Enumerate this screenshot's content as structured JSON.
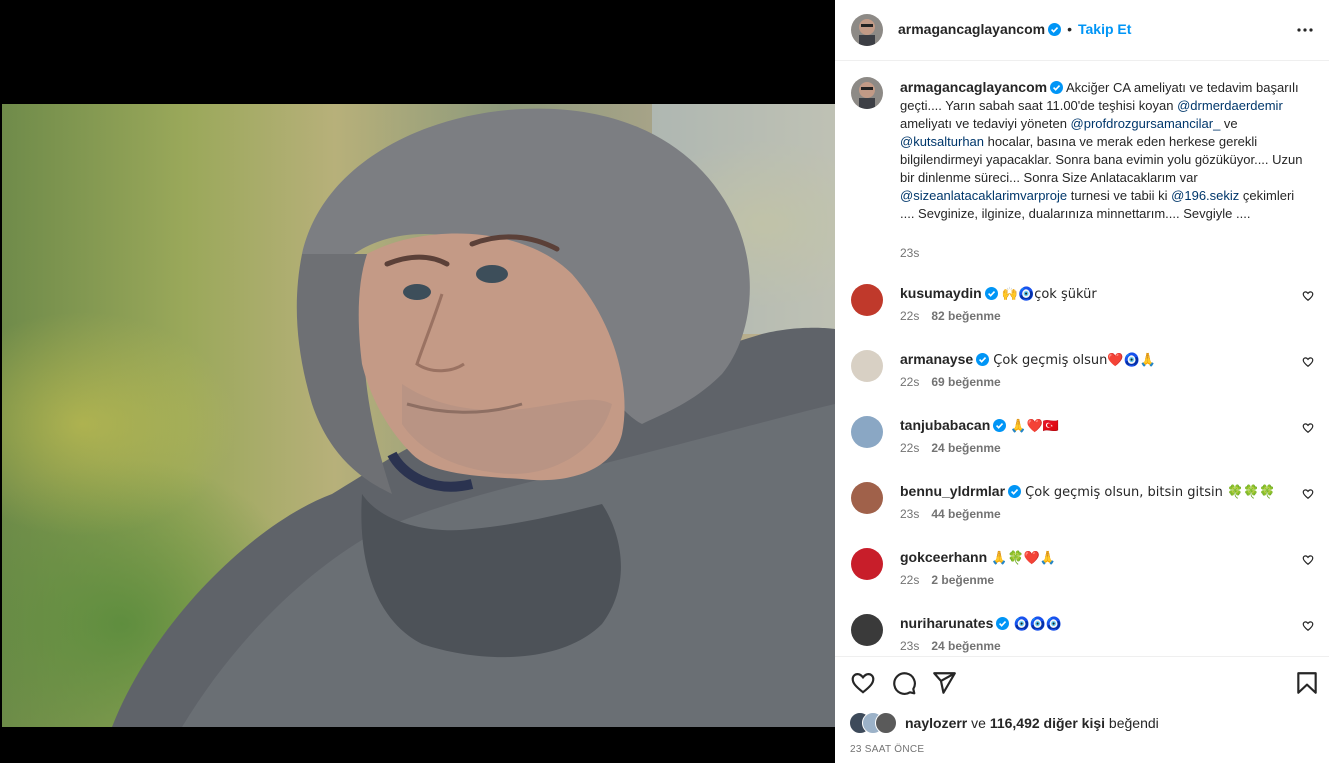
{
  "post": {
    "author": "armagancaglayancom",
    "follow_label": "Takip Et",
    "dot": "•",
    "caption_parts": [
      {
        "t": "Akciğer CA ameliyatı ve tedavim başarılı geçti.... Yarın sabah saat 11.00'de teşhisi koyan ",
        "m": false
      },
      {
        "t": "@drmerdaerdemir",
        "m": true
      },
      {
        "t": " ameliyatı ve tedaviyi yöneten ",
        "m": false
      },
      {
        "t": "@profdrozgursamancilar_",
        "m": true
      },
      {
        "t": " ve ",
        "m": false
      },
      {
        "t": "@kutsalturhan",
        "m": true
      },
      {
        "t": " hocalar, basına ve merak eden herkese gerekli bilgilendirmeyi yapacaklar. Sonra bana evimin yolu gözüküyor.... Uzun bir dinlenme süreci... Sonra Size Anlatacaklarım var ",
        "m": false
      },
      {
        "t": "@sizeanlatacaklarimvarproje",
        "m": true
      },
      {
        "t": " turnesi ve tabii ki ",
        "m": false
      },
      {
        "t": "@196.sekiz",
        "m": true
      },
      {
        "t": " çekimleri .... Sevginize, ilginize, dualarınıza minnettarım.... Sevgiyle ....",
        "m": false
      }
    ],
    "caption_time": "23s"
  },
  "comments": [
    {
      "user": "kusumaydin",
      "verified": true,
      "text": "🙌🧿çok şükür",
      "time": "22s",
      "likes": "82 beğenme",
      "avatar_color": "#c0392b"
    },
    {
      "user": "armanayse",
      "verified": true,
      "text": "Çok geçmiş olsun❤️🧿🙏",
      "time": "22s",
      "likes": "69 beğenme",
      "avatar_color": "#d8d0c4"
    },
    {
      "user": "tanjubabacan",
      "verified": true,
      "text": "🙏❤️🇹🇷",
      "time": "22s",
      "likes": "24 beğenme",
      "avatar_color": "#8aa7c4"
    },
    {
      "user": "bennu_yldrmlar",
      "verified": true,
      "text": "Çok geçmiş olsun, bitsin gitsin 🍀🍀🍀",
      "time": "23s",
      "likes": "44 beğenme",
      "avatar_color": "#a0614a"
    },
    {
      "user": "gokceerhann",
      "verified": false,
      "text": "🙏🍀❤️🙏",
      "time": "22s",
      "likes": "2 beğenme",
      "avatar_color": "#c81e2a"
    },
    {
      "user": "nuriharunates",
      "verified": true,
      "text": "🧿🧿🧿",
      "time": "23s",
      "likes": "24 beğenme",
      "avatar_color": "#3a3a3a"
    }
  ],
  "likes": {
    "first_liker": "naylozerr",
    "joiner": " ve ",
    "count_text": "116,492 diğer kişi",
    "suffix": " beğendi"
  },
  "time_ago": "23 SAAT ÖNCE",
  "colors": {
    "link": "#0095f6",
    "mention": "#00376b",
    "verified": "#0095f6",
    "muted": "#737373"
  }
}
